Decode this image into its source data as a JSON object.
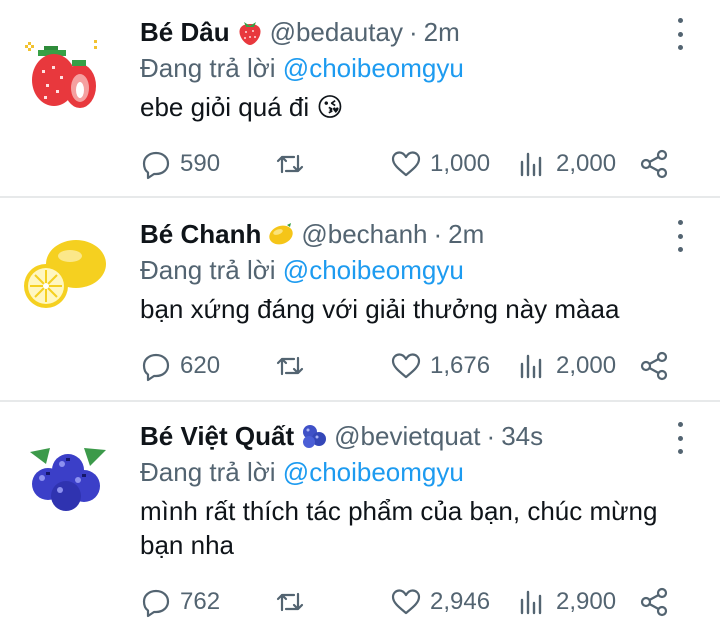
{
  "reply_prefix": "Đang trả lời",
  "tweets": [
    {
      "name": "Bé Dâu",
      "emoji": "strawberry",
      "handle": "@bedautay",
      "separator": "·",
      "time": "2m",
      "mention": "@choibeomgyu",
      "text": "ebe giỏi quá đi 😘",
      "replies": "590",
      "retweets": "",
      "likes": "1,000",
      "views": "2,000",
      "avatar": "strawberry-avatar"
    },
    {
      "name": "Bé Chanh",
      "emoji": "lemon",
      "handle": "@bechanh",
      "separator": "·",
      "time": "2m",
      "mention": "@choibeomgyu",
      "text": "bạn xứng đáng với giải thưởng này màaa",
      "replies": "620",
      "retweets": "",
      "likes": "1,676",
      "views": "2,000",
      "avatar": "lemon-avatar"
    },
    {
      "name": "Bé Việt Quất",
      "emoji": "blueberries",
      "handle": "@bevietquat",
      "separator": "·",
      "time": "34s",
      "mention": "@choibeomgyu",
      "text": "mình rất thích tác phẩm của bạn, chúc mừng bạn nha",
      "replies": "762",
      "retweets": "",
      "likes": "2,946",
      "views": "2,900",
      "avatar": "blueberry-avatar"
    }
  ],
  "colors": {
    "text": "#0f1419",
    "secondary": "#536471",
    "link": "#1d9bf0",
    "divider": "#e7e9ea"
  }
}
